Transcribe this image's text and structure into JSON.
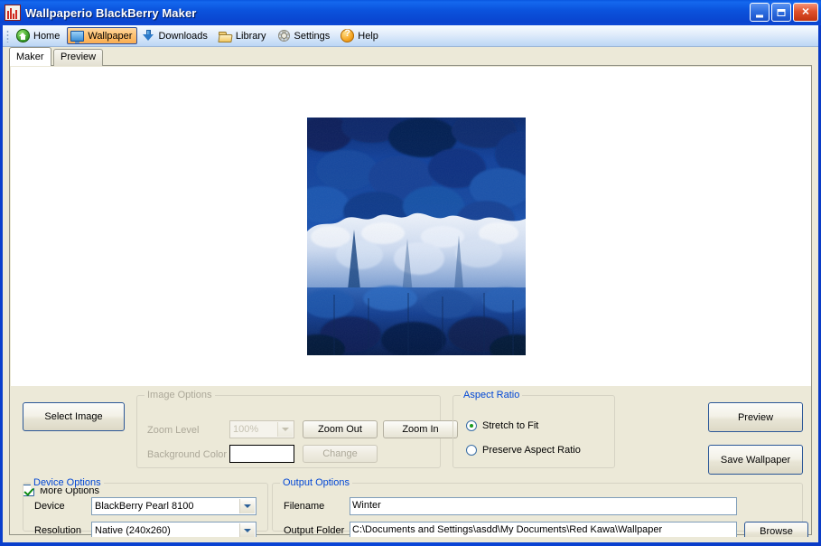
{
  "window": {
    "title": "Wallpaperio BlackBerry Maker",
    "icon": "app-icon",
    "minimize_label": "Minimize",
    "maximize_label": "Maximize",
    "close_label": "Close"
  },
  "toolbar": {
    "items": [
      {
        "label": "Home",
        "icon": "home-icon",
        "active": false
      },
      {
        "label": "Wallpaper",
        "icon": "monitor-icon",
        "active": true
      },
      {
        "label": "Downloads",
        "icon": "download-arrow-icon",
        "active": false
      },
      {
        "label": "Library",
        "icon": "folder-icon",
        "active": false
      },
      {
        "label": "Settings",
        "icon": "gear-icon",
        "active": false
      },
      {
        "label": "Help",
        "icon": "question-mark-icon",
        "active": false
      }
    ]
  },
  "tabs": [
    {
      "label": "Maker",
      "selected": true
    },
    {
      "label": "Preview",
      "selected": false
    }
  ],
  "canvas": {
    "image_alt": "winter-forest-photo",
    "image_colors": {
      "sky_forest_dark": "#0b2f78",
      "forest_mid": "#15479f",
      "frost_white": "#e8eef8",
      "deep_shadow": "#061c4e"
    }
  },
  "select_image_button": "Select Image",
  "more_options": {
    "label": "More Options",
    "checked": true
  },
  "image_options": {
    "title": "Image Options",
    "enabled": false,
    "zoom_level_label": "Zoom Level",
    "zoom_level_value": "100%",
    "background_color_label": "Background Color",
    "background_color_value": "#ffffff",
    "zoom_out_button": "Zoom Out",
    "zoom_in_button": "Zoom In",
    "change_button": "Change"
  },
  "aspect_ratio": {
    "title": "Aspect Ratio",
    "options": [
      {
        "label": "Stretch to Fit",
        "selected": true
      },
      {
        "label": "Preserve Aspect Ratio",
        "selected": false
      }
    ]
  },
  "actions": {
    "preview_button": "Preview",
    "save_wallpaper_button": "Save Wallpaper"
  },
  "device_options": {
    "title": "Device Options",
    "device_label": "Device",
    "device_value": "BlackBerry Pearl 8100",
    "resolution_label": "Resolution",
    "resolution_value": "Native (240x260)"
  },
  "output_options": {
    "title": "Output Options",
    "filename_label": "Filename",
    "filename_value": "Winter",
    "output_folder_label": "Output Folder",
    "output_folder_value": "C:\\Documents and Settings\\asdd\\My Documents\\Red Kawa\\Wallpaper",
    "browse_button": "Browse"
  },
  "colors": {
    "titlebar_blue": "#0b46d8",
    "group_title_blue": "#0046d5",
    "panel_beige": "#ece9d8",
    "active_tool_orange": "#fdbe6c",
    "disabled_gray": "#aca899"
  }
}
